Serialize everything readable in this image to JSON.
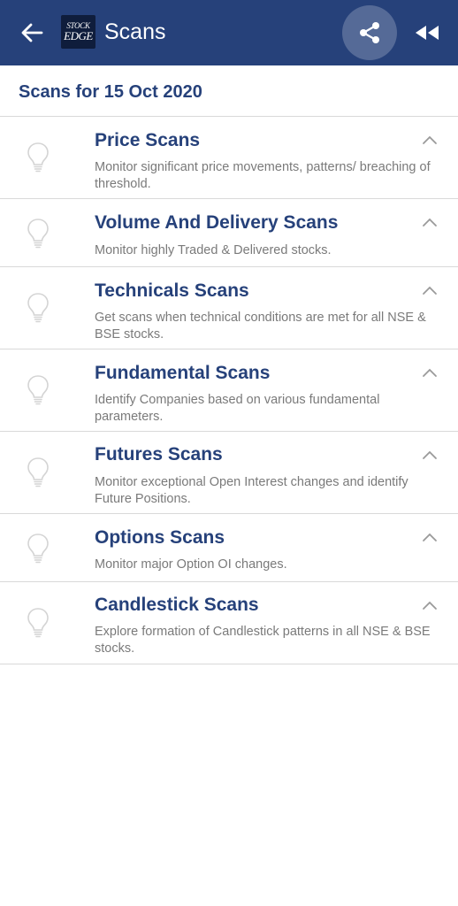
{
  "app": {
    "title": "Scans",
    "logo_line1": "STOCK",
    "logo_line2": "EDGE",
    "brand_color": "#26417a"
  },
  "toolbar": {
    "back_icon": "arrow-left-icon",
    "share_icon": "share-icon",
    "rewind_icon": "rewind-icon"
  },
  "section": {
    "title": "Scans for 15 Oct 2020"
  },
  "scans": [
    {
      "name": "Price Scans",
      "description": "Monitor significant price movements, patterns/ breaching of threshold.",
      "icon": "lightbulb-icon",
      "expanded": true
    },
    {
      "name": "Volume And Delivery Scans",
      "description": "Monitor highly Traded & Delivered stocks.",
      "icon": "lightbulb-icon",
      "expanded": true
    },
    {
      "name": "Technicals Scans",
      "description": "Get scans when technical conditions are met for all NSE & BSE stocks.",
      "icon": "lightbulb-icon",
      "expanded": true
    },
    {
      "name": "Fundamental Scans",
      "description": "Identify Companies based on various fundamental parameters.",
      "icon": "lightbulb-icon",
      "expanded": true
    },
    {
      "name": "Futures Scans",
      "description": "Monitor exceptional Open Interest changes and identify Future Positions.",
      "icon": "lightbulb-icon",
      "expanded": true
    },
    {
      "name": "Options Scans",
      "description": "Monitor major Option OI changes.",
      "icon": "lightbulb-icon",
      "expanded": true
    },
    {
      "name": "Candlestick Scans",
      "description": "Explore formation of Candlestick patterns in all NSE & BSE stocks.",
      "icon": "lightbulb-icon",
      "expanded": true
    }
  ]
}
